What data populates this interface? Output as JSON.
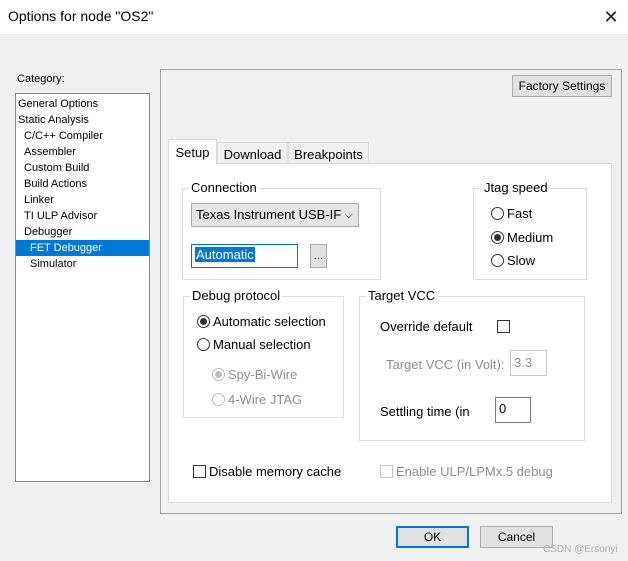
{
  "window": {
    "title": "Options for node \"OS2\"",
    "close_glyph": "✕"
  },
  "category": {
    "label": "Category:",
    "items": [
      "General Options",
      "Static Analysis",
      "C/C++ Compiler",
      "Assembler",
      "Custom Build",
      "Build Actions",
      "Linker",
      "TI ULP Advisor",
      "Debugger",
      "FET Debugger",
      "Simulator"
    ],
    "selected": "FET Debugger"
  },
  "factory_settings_label": "Factory Settings",
  "tabs": [
    "Setup",
    "Download",
    "Breakpoints"
  ],
  "active_tab": "Setup",
  "connection": {
    "label": "Connection",
    "selected": "Texas Instrument USB-IF",
    "arrow_glyph": "⌵",
    "input_value": "Automatic",
    "browse_label": "..."
  },
  "jtag_speed": {
    "label": "Jtag speed",
    "options": [
      "Fast",
      "Medium",
      "Slow"
    ],
    "selected": "Medium"
  },
  "debug_protocol": {
    "label": "Debug protocol",
    "options": [
      "Automatic selection",
      "Manual selection"
    ],
    "selected": "Automatic selection",
    "sub_options": [
      "Spy-Bi-Wire",
      "4-Wire JTAG"
    ],
    "sub_selected": "Spy-Bi-Wire"
  },
  "target_vcc": {
    "label": "Target VCC",
    "override_label": "Override default",
    "override_checked": false,
    "volt_label": "Target VCC (in Volt):",
    "volt_value": "3.3",
    "settling_label": "Settling time (in",
    "settling_value": "0"
  },
  "disable_cache_label": "Disable memory cache",
  "enable_ulp_label": "Enable ULP/LPMx.5 debug",
  "buttons": {
    "ok": "OK",
    "cancel": "Cancel"
  },
  "watermark": "CSDN @Ersonyi",
  "colors": {
    "accent": "#0078d7",
    "dialog_bg": "#f0f0f0"
  }
}
